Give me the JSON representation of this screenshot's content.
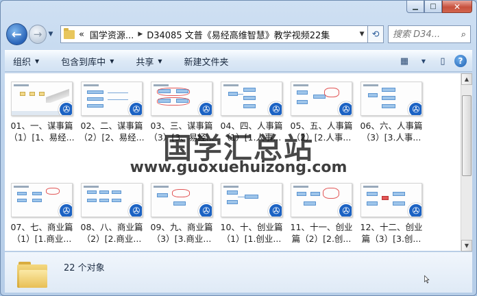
{
  "window": {
    "minimize_icon": "minimize-icon",
    "maximize_icon": "maximize-icon",
    "close_icon": "close-icon"
  },
  "address": {
    "overflow": "«",
    "crumbs": [
      "国学资源...",
      "D34085 文普《易经高维智慧》教学视频22集"
    ],
    "search_placeholder": "搜索 D34..."
  },
  "toolbar": {
    "organize": "组织",
    "include_in_library": "包含到库中",
    "share": "共享",
    "new_folder": "新建文件夹"
  },
  "items": [
    {
      "label": "01、一、谋事篇（1）[1、易经..."
    },
    {
      "label": "02、二、谋事篇（2）[2、易经..."
    },
    {
      "label": "03、三、谋事篇（3）[3、易经..."
    },
    {
      "label": "04、四、人事篇（1）[1.人事..."
    },
    {
      "label": "05、五、人事篇（2）[2.人事..."
    },
    {
      "label": "06、六、人事篇（3）[3.人事..."
    },
    {
      "label": "07、七、商业篇（1）[1.商业..."
    },
    {
      "label": "08、八、商业篇（2）[2.商业..."
    },
    {
      "label": "09、九、商业篇（3）[3.商业..."
    },
    {
      "label": "10、十、创业篇（1）[1.创业..."
    },
    {
      "label": "11、十一、创业篇（2）[2.创..."
    },
    {
      "label": "12、十二、创业篇（3）[3.创..."
    }
  ],
  "watermark": {
    "title": "国学汇总站",
    "url": "www.guoxuehuizong.com"
  },
  "status": {
    "count": "22 个对象"
  },
  "colors": {
    "accent": "#1c63c4",
    "close": "#c7513d"
  }
}
